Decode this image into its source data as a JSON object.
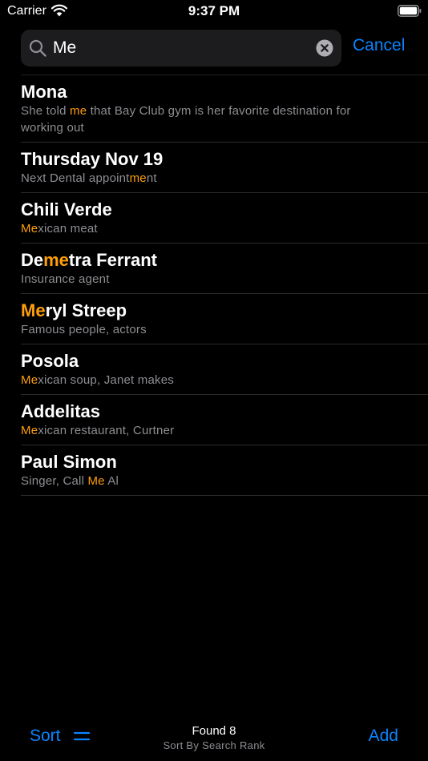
{
  "status_bar": {
    "carrier": "Carrier",
    "time": "9:37 PM"
  },
  "search": {
    "value": "Me",
    "cancel_label": "Cancel"
  },
  "colors": {
    "accent": "#0a84ff",
    "highlight": "#ff9f0a",
    "secondary_text": "#8e8e93",
    "background": "#000000"
  },
  "results": [
    {
      "title": [
        "Mona"
      ],
      "subtitle": [
        "She told ",
        "me",
        " that Bay Club gym is her favorite destination for working out"
      ]
    },
    {
      "title": [
        "Thursday Nov 19"
      ],
      "subtitle": [
        "Next Dental appoint",
        "me",
        "nt"
      ]
    },
    {
      "title": [
        "Chili Verde"
      ],
      "subtitle": [
        "",
        "Me",
        "xican meat"
      ]
    },
    {
      "title": [
        "De",
        "me",
        "tra Ferrant"
      ],
      "subtitle": [
        "Insurance agent"
      ]
    },
    {
      "title": [
        "",
        "Me",
        "ryl Streep"
      ],
      "subtitle": [
        "Famous people, actors"
      ]
    },
    {
      "title": [
        "Posola"
      ],
      "subtitle": [
        "",
        "Me",
        "xican soup, Janet makes"
      ]
    },
    {
      "title": [
        "Addelitas"
      ],
      "subtitle": [
        "",
        "Me",
        "xican restaurant, Curtner"
      ]
    },
    {
      "title": [
        "Paul Simon"
      ],
      "subtitle": [
        "Singer, Call ",
        "Me",
        " Al"
      ]
    }
  ],
  "toolbar": {
    "sort_label": "Sort",
    "found_label": "Found 8",
    "sort_mode": "Sort By Search Rank",
    "add_label": "Add"
  }
}
